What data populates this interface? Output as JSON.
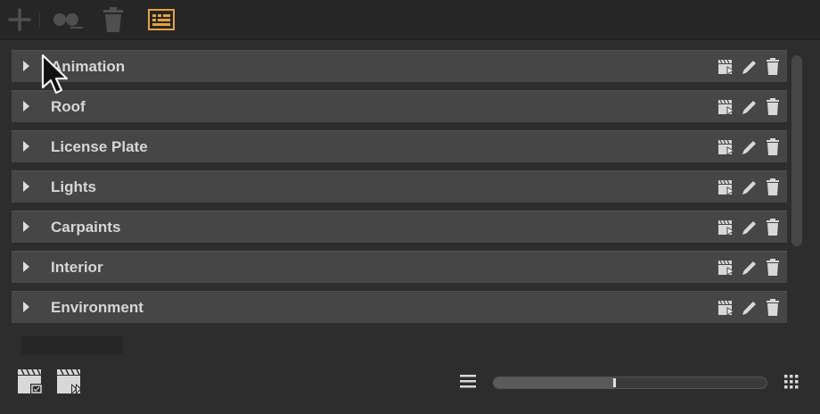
{
  "toolbar": {
    "icons": [
      "add-icon",
      "sequence-icon",
      "trash-icon",
      "switch-panel-icon"
    ]
  },
  "groups": [
    {
      "label": "Animation"
    },
    {
      "label": "Roof"
    },
    {
      "label": "License Plate"
    },
    {
      "label": "Lights"
    },
    {
      "label": "Carpaints"
    },
    {
      "label": "Interior"
    },
    {
      "label": "Environment"
    }
  ],
  "row_actions": [
    "clapper-play-icon",
    "pencil-icon",
    "trash-icon"
  ],
  "footer": {
    "zoom_level": 0.44,
    "icons": [
      "add-animation-icon",
      "play-all-icon",
      "list-view-icon",
      "grid-view-icon"
    ]
  },
  "colors": {
    "accent": "#e6a23c",
    "row_bg": "#464646",
    "text": "#d6d6d6"
  }
}
